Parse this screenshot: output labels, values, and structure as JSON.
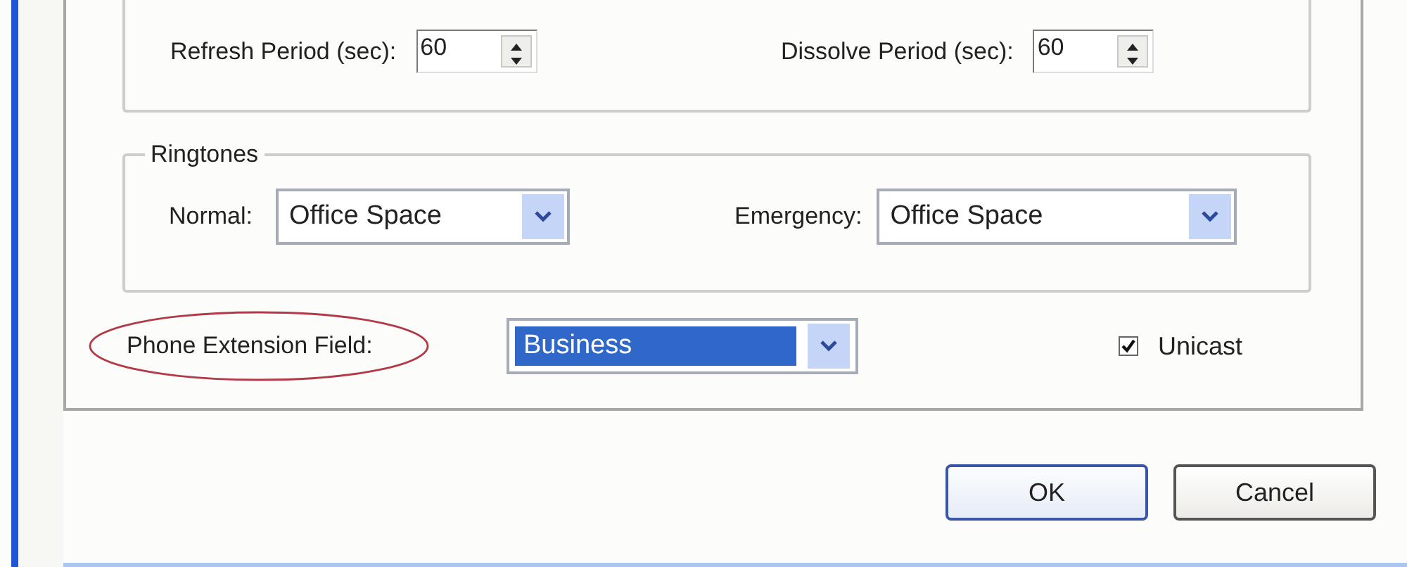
{
  "timing": {
    "fields": [
      {
        "label": "Refresh Period (sec):",
        "value": "60"
      },
      {
        "label": "Dissolve Period (sec):",
        "value": "60"
      }
    ]
  },
  "ringtones": {
    "title": "Ringtones",
    "fields": [
      {
        "label": "Normal:",
        "value": "Office Space"
      },
      {
        "label": "Emergency:",
        "value": "Office Space"
      }
    ]
  },
  "phone_extension": {
    "label": "Phone Extension Field:",
    "value": "Business",
    "highlighted": true,
    "value_selected": true
  },
  "unicast": {
    "label": "Unicast",
    "checked": true
  },
  "buttons": [
    {
      "label": "OK",
      "default": true
    },
    {
      "label": "Cancel",
      "default": false
    }
  ]
}
